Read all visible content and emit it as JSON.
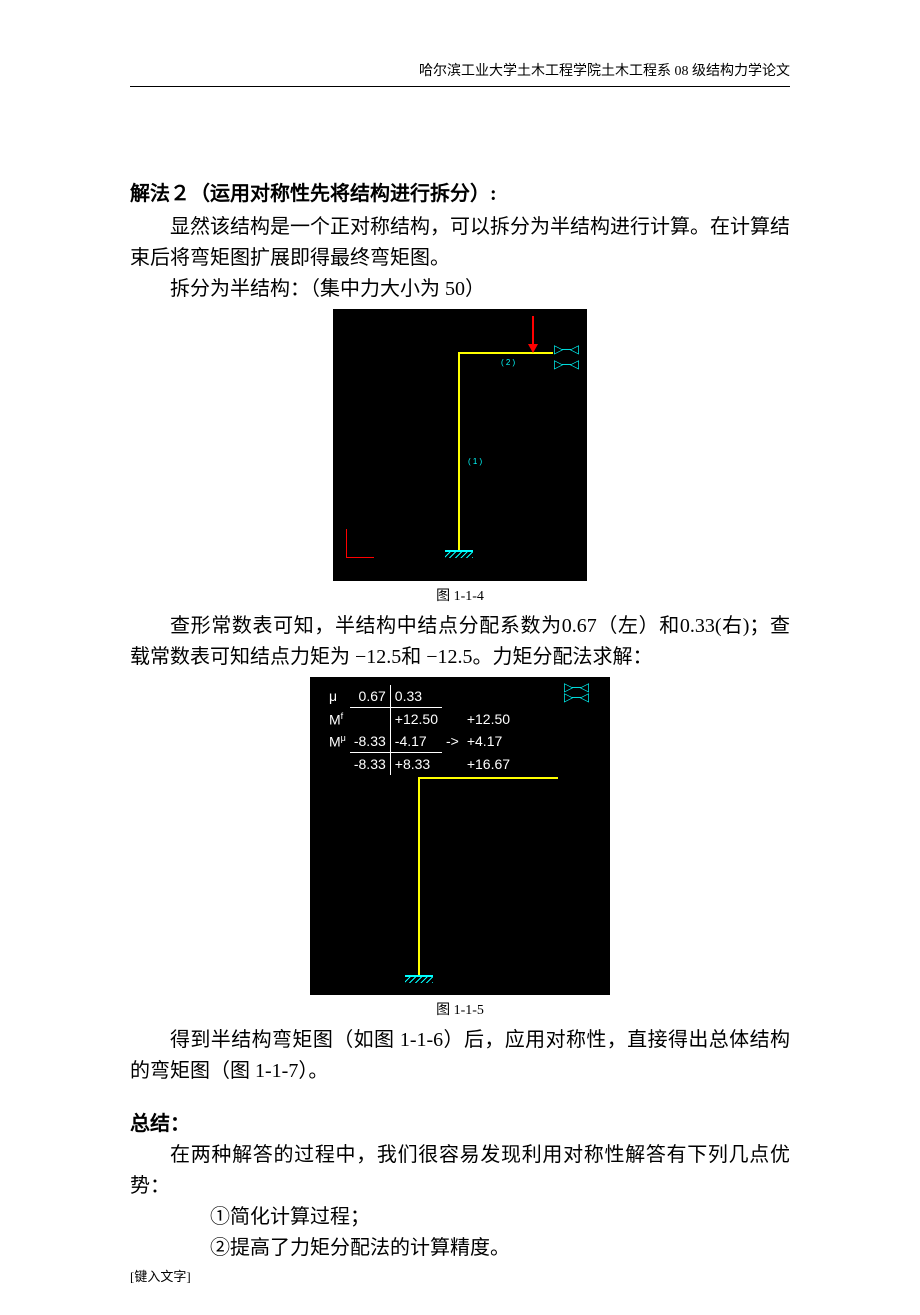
{
  "header": "哈尔滨工业大学土木工程学院土木工程系 08 级结构力学论文",
  "method2": {
    "title": "解法２（运用对称性先将结构进行拆分）:",
    "p1": "显然该结构是一个正对称结构，可以拆分为半结构进行计算。在计算结束后将弯矩图扩展即得最终弯矩图。",
    "p2": "拆分为半结构：（集中力大小为 50）",
    "fig1_lbl1": "( 1 )",
    "fig1_lbl2": "( 2 )",
    "caption1": "图 1-1-4",
    "p3": "查形常数表可知，半结构中结点分配系数为0.67（左）和0.33(右)；查载常数表可知结点力矩为 −12.5和 −12.5。力矩分配法求解：",
    "caption2": "图 1-1-5",
    "p4": "得到半结构弯矩图（如图 1-1-6）后，应用对称性，直接得出总体结构的弯矩图（图 1-1-7）。"
  },
  "chart_data": [
    {
      "type": "table",
      "title": "力矩分配法计算表",
      "rows": [
        {
          "label": "μ",
          "col1": "0.67",
          "col2": "0.33",
          "mid": "",
          "col3": ""
        },
        {
          "label": "Mᶠ",
          "col1": "",
          "col2": "+12.50",
          "mid": "",
          "col3": "+12.50"
        },
        {
          "label": "Mᵘ",
          "col1": "-8.33",
          "col2": "-4.17",
          "mid": "->",
          "col3": "+4.17"
        },
        {
          "label": "",
          "col1": "-8.33",
          "col2": "+8.33",
          "mid": "",
          "col3": "+16.67"
        }
      ]
    }
  ],
  "summary": {
    "title": "总结：",
    "p1": "在两种解答的过程中，我们很容易发现利用对称性解答有下列几点优势：",
    "item1": "①简化计算过程；",
    "item2": "②提高了力矩分配法的计算精度。"
  },
  "footer": "[键入文字]"
}
